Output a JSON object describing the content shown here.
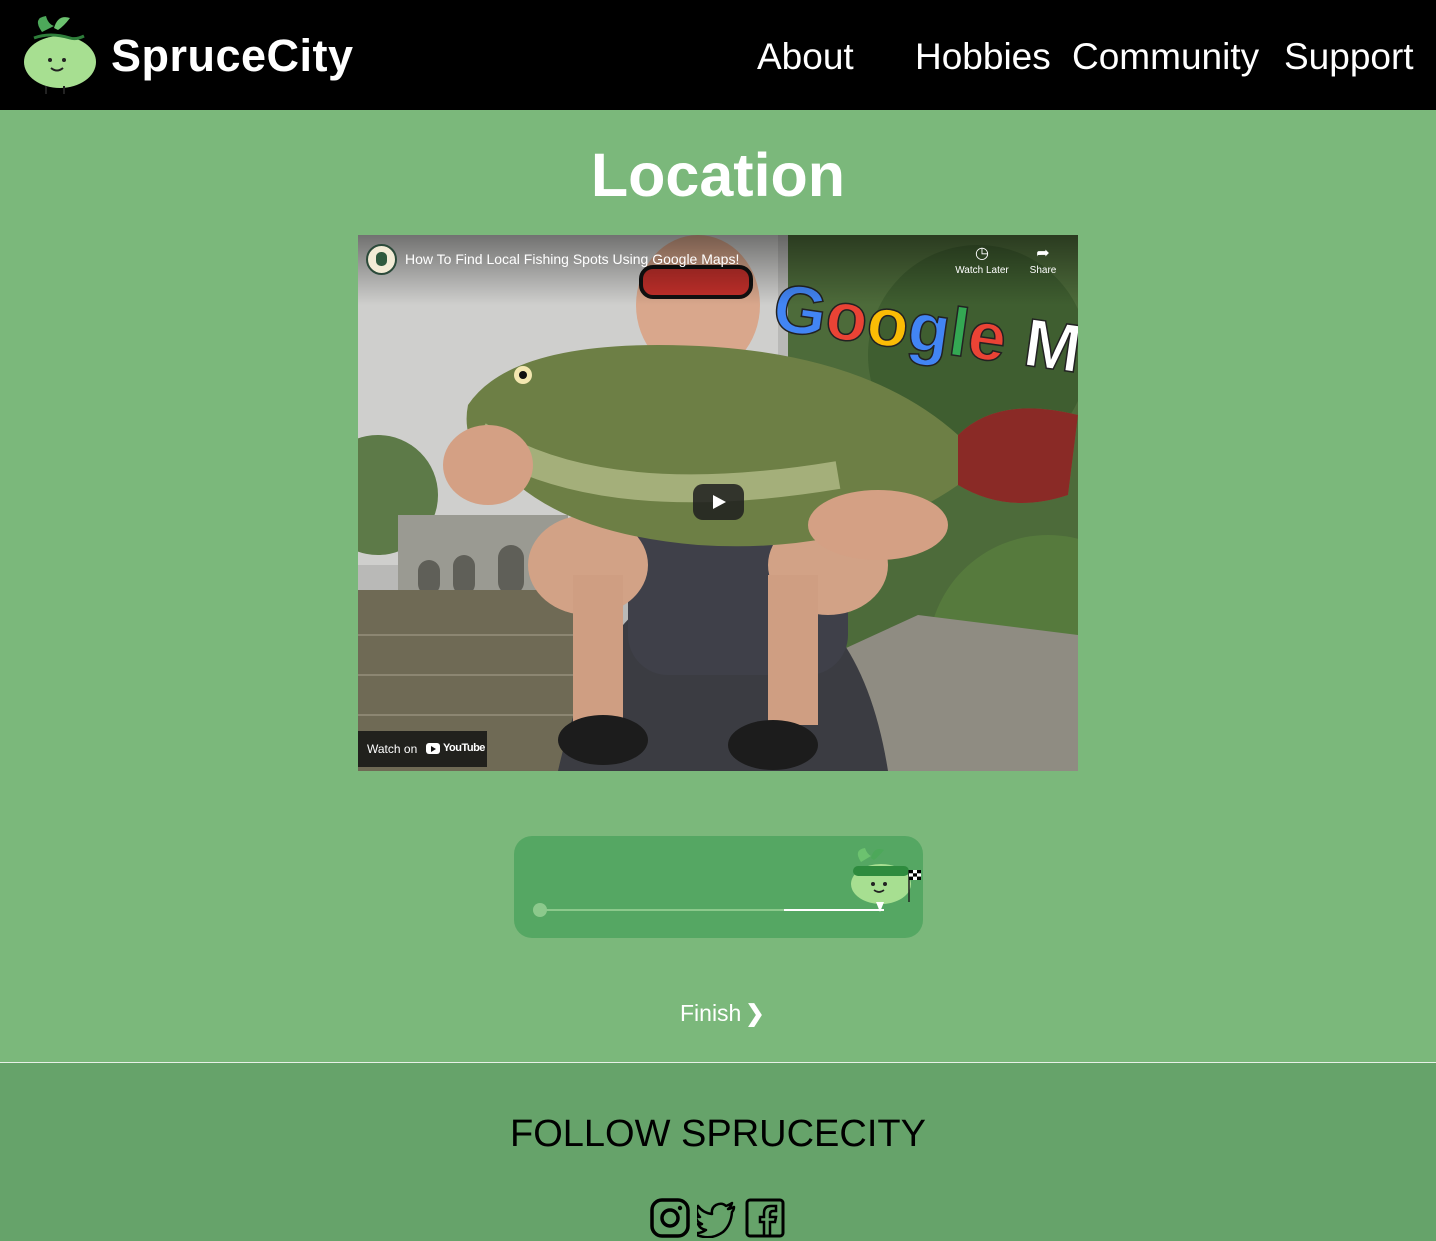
{
  "brand": {
    "name": "SpruceCity"
  },
  "nav": {
    "about": "About",
    "hobbies": "Hobbies",
    "community": "Community",
    "support": "Support"
  },
  "page": {
    "title": "Location"
  },
  "video": {
    "title": "How To Find Local Fishing Spots Using Google Maps!",
    "watch_later": "Watch Later",
    "share": "Share",
    "watch_on": "Watch on",
    "youtube": "YouTube",
    "overlay_text": "Google Ma"
  },
  "progress": {
    "fraction": 0.7
  },
  "finish": {
    "label": "Finish"
  },
  "footer": {
    "follow": "FOLLOW SPRUCECITY",
    "social_icons": [
      "instagram-icon",
      "twitter-icon",
      "facebook-icon"
    ]
  },
  "colors": {
    "header_bg": "#000000",
    "page_bg": "#7bb87b",
    "card_bg": "#55a763",
    "footer_bg": "#66a36a"
  }
}
